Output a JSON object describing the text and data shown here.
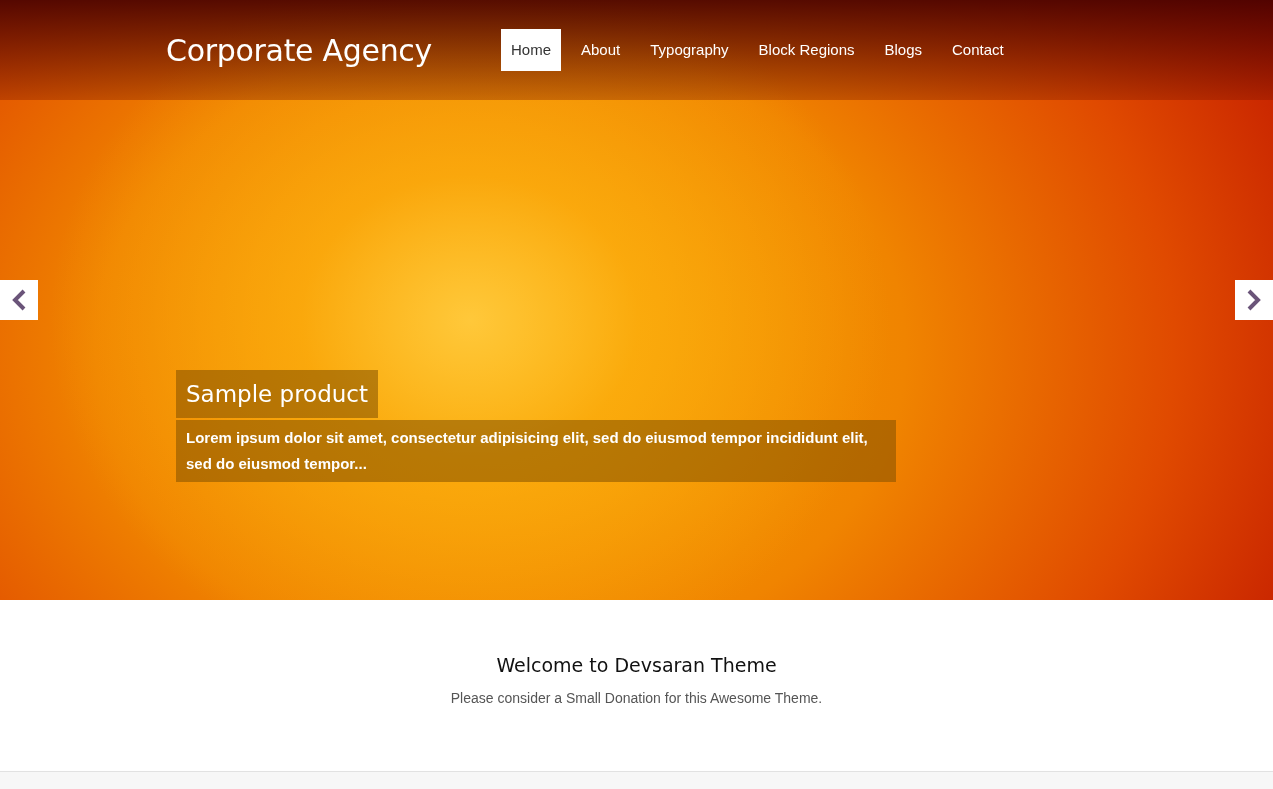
{
  "site_title": "Corporate Agency",
  "nav": [
    {
      "label": "Home",
      "selected": true
    },
    {
      "label": "About",
      "selected": false
    },
    {
      "label": "Typography",
      "selected": false
    },
    {
      "label": "Block Regions",
      "selected": false
    },
    {
      "label": "Blogs",
      "selected": false
    },
    {
      "label": "Contact",
      "selected": false
    }
  ],
  "slide": {
    "title": "Sample product",
    "text": "Lorem ipsum dolor sit amet, consectetur adipisicing elit, sed do eiusmod tempor incididunt elit, sed do eiusmod tempor..."
  },
  "welcome": {
    "heading": "Welcome to Devsaran Theme",
    "text": "Please consider a Small Donation for this Awesome Theme."
  }
}
